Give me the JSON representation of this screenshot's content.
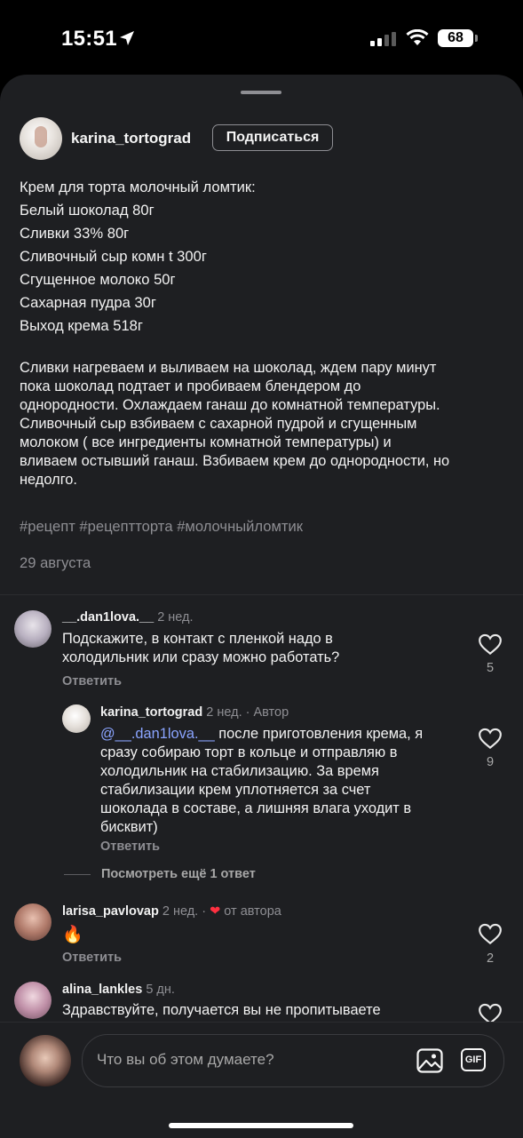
{
  "status_bar": {
    "time": "15:51",
    "battery": "68"
  },
  "post": {
    "username": "karina_tortograd",
    "follow_label": "Подписаться",
    "caption_lines": [
      "Крем для торта молочный ломтик:",
      "Белый шоколад 80г",
      "Сливки 33% 80г",
      "Сливочный сыр комн t 300г",
      "Сгущенное молоко 50г",
      "Сахарная пудра 30г",
      "Выход крема 518г"
    ],
    "paragraph_lines": [
      "Сливки нагреваем и выливаем на шоколад, ждем пару минут",
      "пока шоколад подтает и пробиваем блендером до",
      "однородности. Охлаждаем ганаш до комнатной температуры.",
      "Сливочный сыр взбиваем с сахарной пудрой и сгущенным",
      "молоком ( все ингредиенты комнатной температуры) и",
      "вливаем остывший ганаш. Взбиваем крем до однородности, но",
      "недолго."
    ],
    "hashtags": "#рецепт #рецепттортa #молочныйломтик",
    "date": "29 августа"
  },
  "comments": [
    {
      "username": "__.dan1lova.__",
      "time": "2 нед.",
      "text_lines": [
        "Подскажите, в контакт с пленкой надо в",
        "холодильник или сразу можно работать?"
      ],
      "reply_label": "Ответить",
      "likes": "5"
    },
    {
      "username": "karina_tortograd",
      "time": "2 нед.",
      "author_tag": "· Автор",
      "mention": "@__.dan1lova.__",
      "text_lines": [
        " после приготовления крема, я",
        "сразу собираю торт в кольце и отправляю в",
        "холодильник на стабилизацию. За время",
        "стабилизации крем уплотняется за счет",
        "шоколада в составе, а лишняя влага уходит в",
        "бисквит)"
      ],
      "reply_label": "Ответить",
      "likes": "9"
    },
    {
      "username": "larisa_pavlovap",
      "time": "2 нед.",
      "from_author": "от автора",
      "text_lines": [
        "🔥"
      ],
      "reply_label": "Ответить",
      "likes": "2"
    },
    {
      "username": "alina_lankles",
      "time": "5 дн.",
      "text_lines": [
        "Здравствуйте, получается вы не пропитываете"
      ]
    }
  ],
  "more_replies": "Посмотреть ещё 1 ответ",
  "composer": {
    "placeholder": "Что вы об этом думаете?",
    "gif_label": "GIF"
  },
  "colors": {
    "sheet_bg": "#1e1f22",
    "mention": "#8aa4ff",
    "heart_red": "#ff3040",
    "muted": "#8e8e93"
  }
}
